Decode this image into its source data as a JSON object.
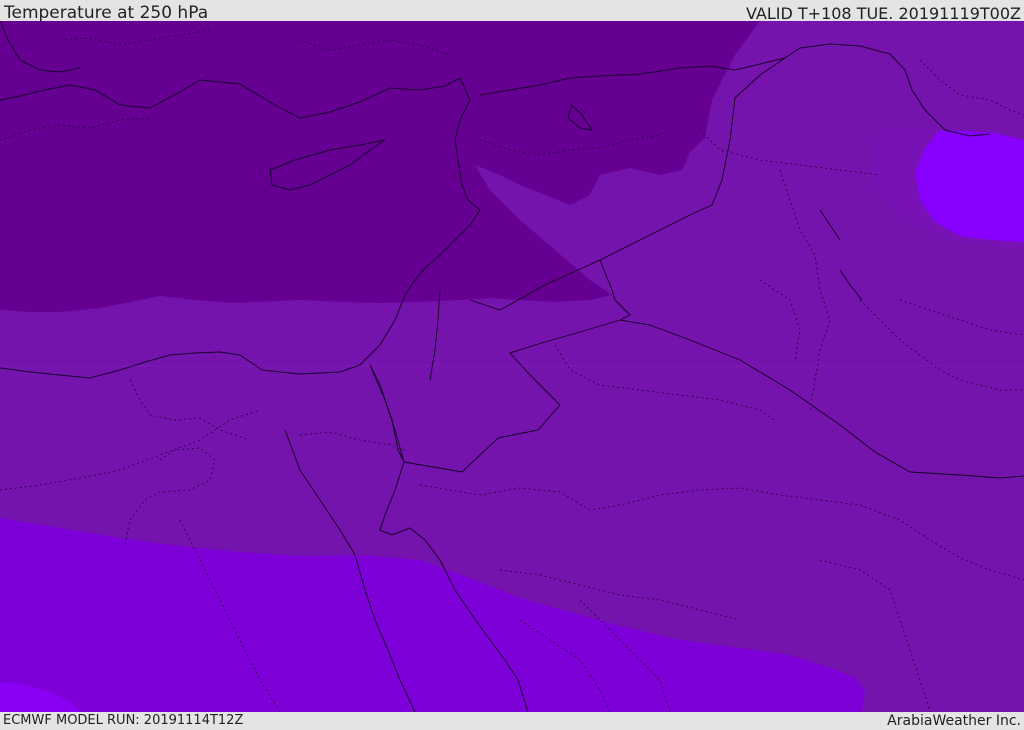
{
  "header": {
    "title": "Temperature at 250 hPa",
    "valid": "VALID T+108 TUE. 20191119T00Z"
  },
  "footer": {
    "model_run": "ECMWF MODEL RUN: 20191114T12Z",
    "brand": "ArabiaWeather Inc."
  },
  "map": {
    "field": "temperature",
    "level": "250 hPa",
    "colors": {
      "coldest_band": "#650092",
      "band_2": "#7513ad",
      "band_3": "#7e00d9",
      "band_4": "#8a00f4",
      "warmest_band": "#9000ff",
      "coastline": "#1a0030",
      "internal_border": "#2a0045"
    }
  }
}
